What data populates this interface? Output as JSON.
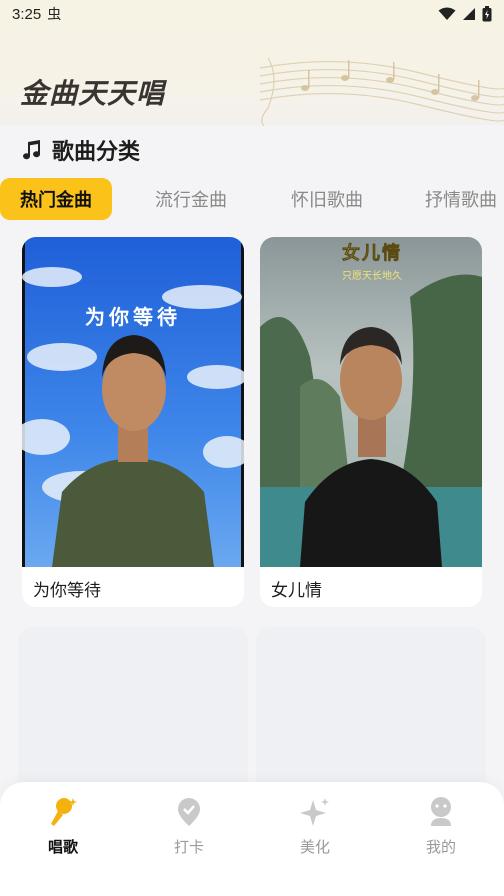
{
  "status_bar": {
    "time": "3:25",
    "left_icon": "虫"
  },
  "app": {
    "title": "金曲天天唱"
  },
  "section": {
    "icon": "music-note-icon",
    "title": "歌曲分类"
  },
  "tabs": [
    {
      "label": "热门金曲",
      "active": true
    },
    {
      "label": "流行金曲",
      "active": false
    },
    {
      "label": "怀旧歌曲",
      "active": false
    },
    {
      "label": "抒情歌曲",
      "active": false
    }
  ],
  "songs": [
    {
      "title": "为你等待",
      "cover_text": "为你等待"
    },
    {
      "title": "女儿情",
      "cover_text": "女儿情",
      "cover_subtext": "只愿天长地久"
    }
  ],
  "bottom_nav": [
    {
      "label": "唱歌",
      "icon": "microphone-icon",
      "active": true
    },
    {
      "label": "打卡",
      "icon": "location-pin-icon",
      "active": false
    },
    {
      "label": "美化",
      "icon": "sparkle-icon",
      "active": false
    },
    {
      "label": "我的",
      "icon": "user-icon",
      "active": false
    }
  ],
  "colors": {
    "accent": "#fbc31a",
    "active_nav": "#f5b20f"
  }
}
